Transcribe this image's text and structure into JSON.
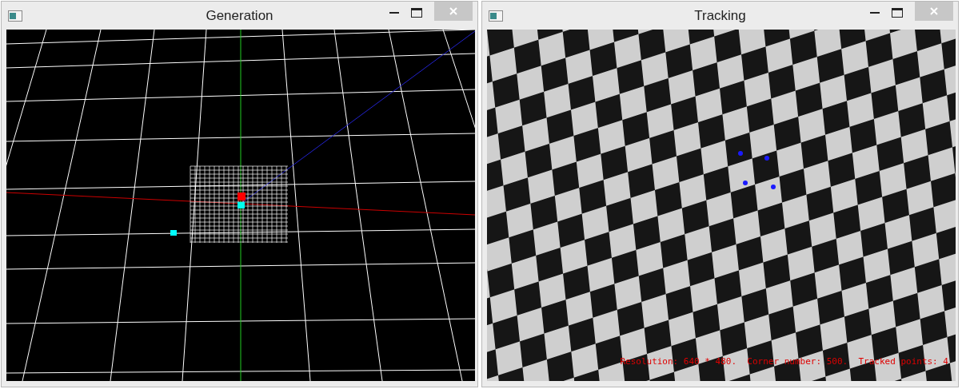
{
  "windows": [
    {
      "title": "Generation",
      "kind": "scene"
    },
    {
      "title": "Tracking",
      "kind": "camera",
      "overlay": "Resolution: 640 * 480.  Corner number: 500.  Tracked points: 4"
    }
  ]
}
